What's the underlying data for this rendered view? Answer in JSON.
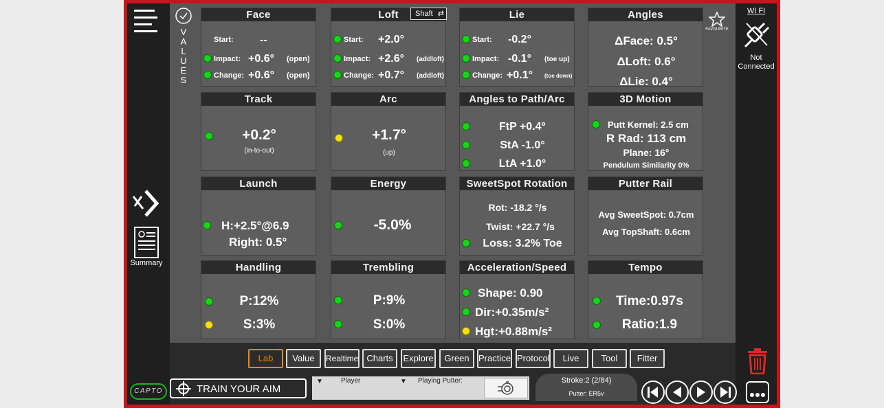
{
  "values_label": "VALUES",
  "summary_label": "Summary",
  "favourite_label": "FAVOURITE",
  "wifi_label": "WI FI",
  "connection": {
    "line1": "Not",
    "line2": "Connected"
  },
  "face": {
    "title": "Face",
    "start_label": "Start:",
    "start_value": "--",
    "impact_label": "Impact:",
    "impact_value": "+0.6°",
    "impact_note": "(open)",
    "change_label": "Change:",
    "change_value": "+0.6°",
    "change_note": "(open)"
  },
  "loft": {
    "title": "Loft",
    "shaft_label": "Shaft",
    "start_label": "Start:",
    "start_value": "+2.0°",
    "impact_label": "Impact:",
    "impact_value": "+2.6°",
    "impact_note": "(addloft)",
    "change_label": "Change:",
    "change_value": "+0.7°",
    "change_note": "(addloft)"
  },
  "lie": {
    "title": "Lie",
    "start_label": "Start:",
    "start_value": "-0.2°",
    "impact_label": "Impact:",
    "impact_value": "-0.1°",
    "impact_note": "(toe up)",
    "change_label": "Change:",
    "change_value": "+0.1°",
    "change_note": "(toe down)"
  },
  "angles": {
    "title": "Angles",
    "l1": "ΔFace: 0.5°",
    "l2": "ΔLoft: 0.6°",
    "l3": "ΔLie: 0.4°"
  },
  "track": {
    "title": "Track",
    "value": "+0.2°",
    "note": "(in-to-out)"
  },
  "arc": {
    "title": "Arc",
    "value": "+1.7°",
    "note": "(up)"
  },
  "angles_path": {
    "title": "Angles to Path/Arc",
    "l1": "FtP +0.4°",
    "l2": "StA -1.0°",
    "l3": "LtA +1.0°"
  },
  "motion3d": {
    "title": "3D Motion",
    "l1": "Putt Kernel: 2.5 cm",
    "l2": "R Rad: 113 cm",
    "l3": "Plane: 16°",
    "l4": "Pendulum Similarity 0%"
  },
  "launch": {
    "title": "Launch",
    "l1": "H:+2.5°@6.9",
    "l2": "Right: 0.5°"
  },
  "energy": {
    "title": "Energy",
    "value": "-5.0%"
  },
  "sweetspot": {
    "title": "SweetSpot Rotation",
    "l1": "Rot: -18.2 °/s",
    "l2": "Twist: +22.7 °/s",
    "l3": "Loss: 3.2% Toe"
  },
  "putter_rail": {
    "title": "Putter Rail",
    "l1": "Avg SweetSpot: 0.7cm",
    "l2": "Avg TopShaft: 0.6cm"
  },
  "handling": {
    "title": "Handling",
    "l1": "P:12%",
    "l2": "S:3%"
  },
  "trembling": {
    "title": "Trembling",
    "l1": "P:9%",
    "l2": "S:0%"
  },
  "accel": {
    "title": "Acceleration/Speed",
    "l1": "Shape: 0.90",
    "l2": "Dir:+0.35m/s²",
    "l3": "Hgt:+0.88m/s²"
  },
  "tempo": {
    "title": "Tempo",
    "l1": "Time:0.97s",
    "l2": "Ratio:1.9"
  },
  "tabs": [
    "Lab",
    "Value",
    "Realtime",
    "Charts",
    "Explore",
    "Green",
    "Practice",
    "Protocol",
    "Live",
    "Tool",
    "Fitter"
  ],
  "active_tab": "Lab",
  "logo_text": "CAPTO",
  "train_label": "TRAIN YOUR AIM",
  "player_label": "Player",
  "playing_putter_label": "Playing Putter:",
  "stroke_label": "Stroke:2 (2/84)",
  "putter_label": "Putter: ER5v",
  "colors": {
    "frame": "#c8151b",
    "ok": "#19d419",
    "warn": "#f2e016",
    "accent": "#e6891a"
  }
}
